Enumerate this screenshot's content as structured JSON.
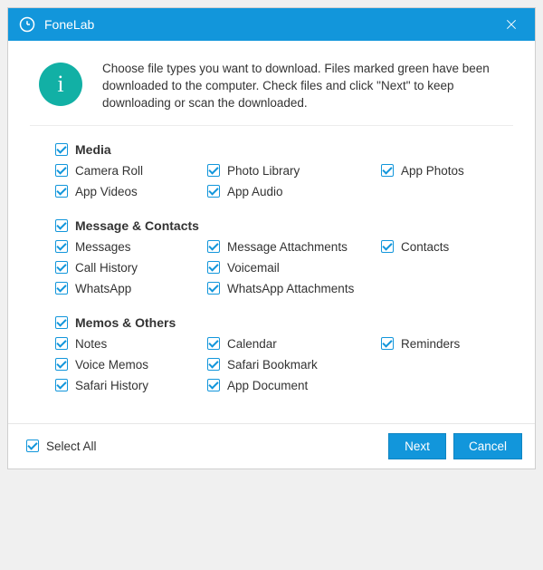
{
  "titlebar": {
    "title": "FoneLab"
  },
  "instruction": "Choose file types you want to download. Files marked green have been downloaded to the computer. Check files and click \"Next\" to keep downloading or scan the downloaded.",
  "groups": [
    {
      "title": "Media",
      "items": [
        {
          "label": "Camera Roll",
          "checked": true
        },
        {
          "label": "Photo Library",
          "checked": true
        },
        {
          "label": "App Photos",
          "checked": true
        },
        {
          "label": "App Videos",
          "checked": true
        },
        {
          "label": "App Audio",
          "checked": true
        }
      ]
    },
    {
      "title": "Message & Contacts",
      "items": [
        {
          "label": "Messages",
          "checked": true
        },
        {
          "label": "Message Attachments",
          "checked": true
        },
        {
          "label": "Contacts",
          "checked": true
        },
        {
          "label": "Call History",
          "checked": true
        },
        {
          "label": "Voicemail",
          "checked": true
        },
        {
          "label": "",
          "checked": false,
          "empty": true
        },
        {
          "label": "WhatsApp",
          "checked": true
        },
        {
          "label": "WhatsApp Attachments",
          "checked": true
        }
      ]
    },
    {
      "title": "Memos & Others",
      "items": [
        {
          "label": "Notes",
          "checked": true
        },
        {
          "label": "Calendar",
          "checked": true
        },
        {
          "label": "Reminders",
          "checked": true
        },
        {
          "label": "Voice Memos",
          "checked": true
        },
        {
          "label": "Safari Bookmark",
          "checked": true
        },
        {
          "label": "",
          "checked": false,
          "empty": true
        },
        {
          "label": "Safari History",
          "checked": true
        },
        {
          "label": "App Document",
          "checked": true
        }
      ]
    }
  ],
  "footer": {
    "select_all_label": "Select All",
    "select_all_checked": true,
    "next_label": "Next",
    "cancel_label": "Cancel"
  }
}
